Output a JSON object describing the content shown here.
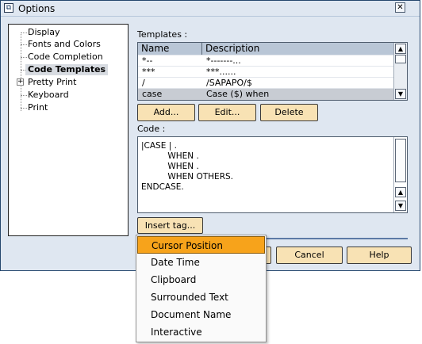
{
  "window": {
    "title": "Options",
    "close_glyph": "✕"
  },
  "tree": {
    "items": [
      {
        "label": "Display"
      },
      {
        "label": "Fonts and Colors"
      },
      {
        "label": "Code Completion"
      },
      {
        "label": "Code Templates",
        "selected": true
      },
      {
        "label": "Pretty Print",
        "expandable": true,
        "expander_glyph": "+"
      },
      {
        "label": "Keyboard"
      },
      {
        "label": "Print"
      }
    ]
  },
  "templates": {
    "label": "Templates :",
    "columns": [
      "Name",
      "Description"
    ],
    "rows": [
      {
        "name": "*--",
        "description": "*-------..."
      },
      {
        "name": "***",
        "description": "***......"
      },
      {
        "name": "/",
        "description": "/SAPAPO/$"
      },
      {
        "name": "case",
        "description": "Case ($) when",
        "selected": true
      }
    ]
  },
  "buttons": {
    "add": "Add...",
    "edit": "Edit...",
    "delete": "Delete"
  },
  "code": {
    "label": "Code :",
    "lines": [
      "|CASE | .",
      "          WHEN .",
      "          WHEN .",
      "          WHEN OTHERS.",
      "ENDCASE."
    ]
  },
  "insert_tag": {
    "label": "Insert tag..."
  },
  "dialog_buttons": {
    "cancel": "Cancel",
    "help": "Help"
  },
  "dropdown": {
    "items": [
      {
        "label": "Cursor Position",
        "selected": true
      },
      {
        "label": "Date Time"
      },
      {
        "label": "Clipboard"
      },
      {
        "label": "Surrounded Text"
      },
      {
        "label": "Document Name"
      },
      {
        "label": "Interactive"
      }
    ]
  },
  "scroll": {
    "up_glyph": "▲",
    "down_glyph": "▼"
  },
  "colors": {
    "accent": "#f7a31b",
    "button": "#f8e2b4",
    "dialog_bg": "#dfe7f1"
  }
}
